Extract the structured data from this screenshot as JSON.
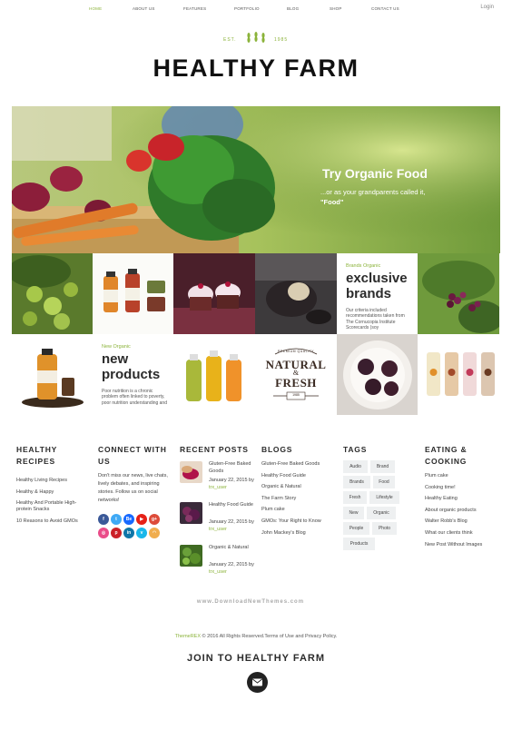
{
  "nav": {
    "items": [
      "HOME",
      "ABOUT US",
      "FEATURES",
      "PORTFOLIO",
      "BLOG",
      "SHOP",
      "CONTACT US"
    ],
    "login": "Login"
  },
  "brand": {
    "est": "EST.",
    "year": "1985",
    "title": "HEALTHY FARM"
  },
  "hero": {
    "headline": "Try Organic Food",
    "subline": "...or as your grandparents called it,",
    "subline_bold": "\"Food\""
  },
  "brands_tile": {
    "kicker": "Brands Organic",
    "line1": "exclusive",
    "line2": "brands",
    "text": "Our criteria included recommendations taken from The Cornucopia Institute Scorecards (soy"
  },
  "products_tile": {
    "kicker": "New Organic",
    "line1": "new",
    "line2": "products",
    "text": "Poor nutrition is a chronic problem often linked to poverty, poor nutrition understanding and"
  },
  "natural_tile": {
    "top": "PREMIUM QUALITY",
    "line1": "NATURAL",
    "amp": "&",
    "line2": "FRESH",
    "since": "1985"
  },
  "footer": {
    "recipes": {
      "title_line1": "HEALTHY",
      "title_line2": "RECIPES",
      "items": [
        "Healthy Living Recipes",
        "Healthy & Happy",
        "Healthy And Portable High-protein Snacks",
        "10 Reasons to Avoid GMOs"
      ]
    },
    "connect": {
      "title_line1": "CONNECT WITH",
      "title_line2": "US",
      "text": "Don't miss our news, live chats, lively debates, and inspiring stories. Follow us on social networks!",
      "icons": [
        {
          "name": "facebook-icon",
          "glyph": "f",
          "color": "#3b5998"
        },
        {
          "name": "twitter-icon",
          "glyph": "t",
          "color": "#3fa9f5"
        },
        {
          "name": "behance-icon",
          "glyph": "Be",
          "color": "#1769ff"
        },
        {
          "name": "youtube-icon",
          "glyph": "▶",
          "color": "#e62117"
        },
        {
          "name": "google-plus-icon",
          "glyph": "g+",
          "color": "#dd4b39"
        },
        {
          "name": "dribbble-icon",
          "glyph": "◎",
          "color": "#ea4c89"
        },
        {
          "name": "pinterest-icon",
          "glyph": "p",
          "color": "#cb2027"
        },
        {
          "name": "linkedin-icon",
          "glyph": "in",
          "color": "#0e76a8"
        },
        {
          "name": "vimeo-icon",
          "glyph": "v",
          "color": "#1ab7ea"
        },
        {
          "name": "rss-icon",
          "glyph": "◠",
          "color": "#f0ad4e"
        }
      ]
    },
    "posts": {
      "title": "RECENT POSTS",
      "items": [
        {
          "title": "Gluten-Free Baked Goods",
          "date": "January 22, 2015 by",
          "author": "trx_user"
        },
        {
          "title": "Healthy Food Guide",
          "date": "January 22, 2015 by",
          "author": "trx_user"
        },
        {
          "title": "Organic & Natural",
          "date": "January 22, 2015 by",
          "author": "trx_user"
        }
      ]
    },
    "blogs": {
      "title": "BLOGS",
      "items": [
        "Gluten-Free Baked Goods",
        "Healthy Food Guide",
        "Organic & Natural",
        "The Farm Story",
        "Plum cake",
        "GMOs: Your Right to Know",
        "John Mackey's Blog"
      ]
    },
    "tags": {
      "title": "TAGS",
      "items": [
        "Audio",
        "Brand",
        "Brands",
        "Food",
        "Fresh",
        "Lifestyle",
        "New",
        "Organic",
        "People",
        "Photo",
        "Products"
      ]
    },
    "eating": {
      "title_line1": "EATING &",
      "title_line2": "COOKING",
      "items": [
        "Plum cake",
        "Cooking time!",
        "Healthy Eating",
        "About organic products",
        "Walter Robb's Blog",
        "What our clients think",
        "New Post Without Images"
      ]
    }
  },
  "watermark": "www.DownloadNewThemes.com",
  "copyright": {
    "brand": "ThemeREX",
    "text": " © 2016 All Rights Reserved.Terms of Use and Privacy Policy."
  },
  "newsletter": {
    "title": "JOIN TO HEALTHY FARM"
  },
  "colors": {
    "accent": "#8bb33a",
    "text": "#2b2b2b"
  }
}
